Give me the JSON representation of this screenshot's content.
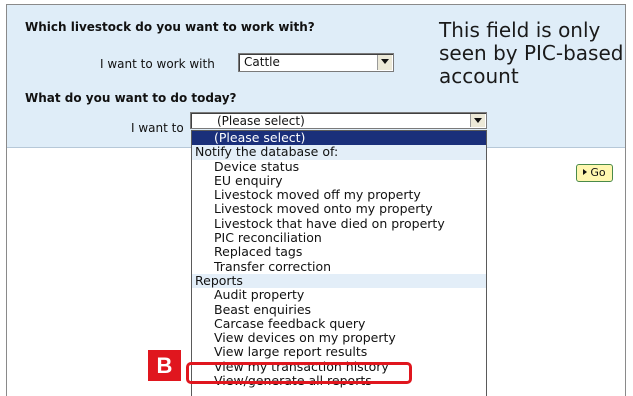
{
  "form": {
    "livestock_question": "Which livestock do you want to work with?",
    "livestock_label": "I want to work with",
    "livestock_value": "Cattle",
    "action_question": "What do you want to do today?",
    "action_label": "I want to",
    "action_value": "(Please select)",
    "go_label": "Go"
  },
  "note": {
    "text": "This field is only seen by PIC-based account"
  },
  "dropdown": {
    "selected_option": "(Please select)",
    "group_notify": "Notify the database of:",
    "notify_items": [
      "Device status",
      "EU enquiry",
      "Livestock moved off my property",
      "Livestock moved onto my property",
      "Livestock that have died on property",
      "PIC reconciliation",
      "Replaced tags",
      "Transfer correction"
    ],
    "group_reports": "Reports",
    "report_items": [
      "Audit property",
      "Beast enquiries",
      "Carcase feedback query",
      "View devices on my property",
      "View large report results",
      "View my transaction history",
      "View/generate all reports"
    ]
  },
  "callout": {
    "badge_letter": "B"
  },
  "colors": {
    "panel_background": "#dfedf8",
    "selected_option_bg": "#1a2f7a",
    "highlight_red": "#e0161e",
    "go_button_bg": "#fff7b0"
  }
}
